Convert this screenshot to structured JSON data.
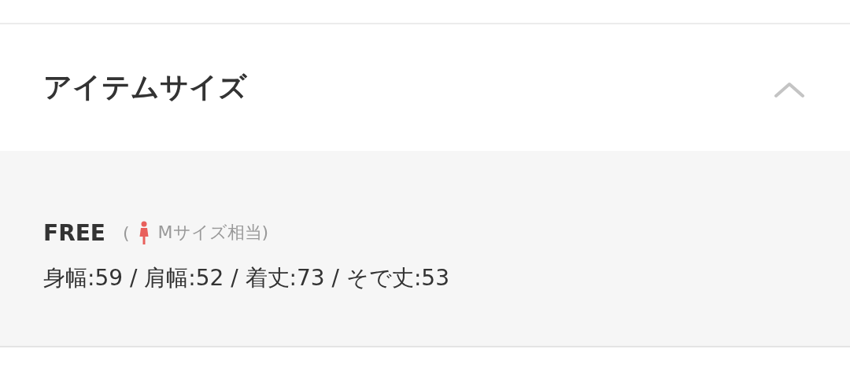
{
  "section": {
    "title": "アイテムサイズ",
    "expanded": true
  },
  "sizes": [
    {
      "size": "FREE",
      "open_paren": "(",
      "equivalent": "Mサイズ相当)",
      "measurements": "身幅:59 / 肩幅:52 / 着丈:73 / そで丈:53"
    }
  ]
}
